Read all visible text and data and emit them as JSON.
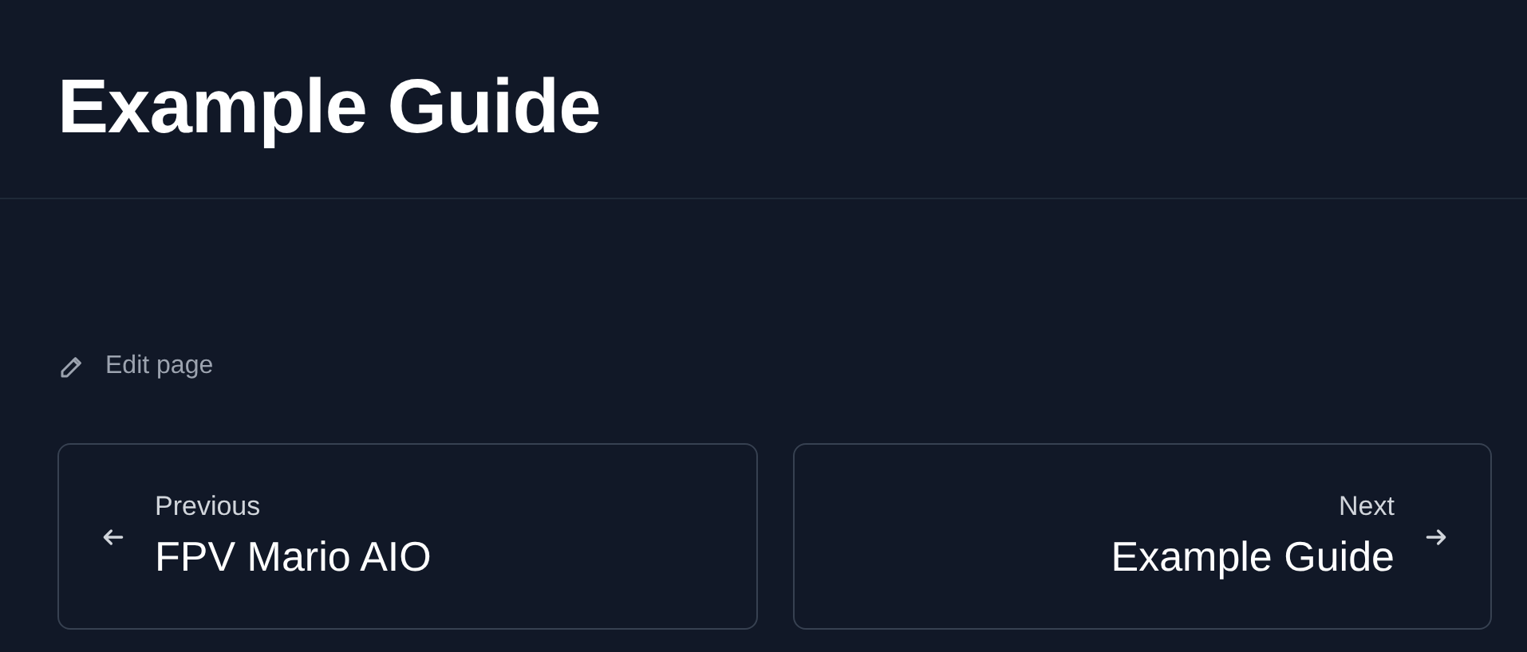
{
  "title": "Example Guide",
  "edit_link": "Edit page",
  "pagination": [
    {
      "kind": "prev",
      "label": "Previous",
      "title": "FPV Mario AIO"
    },
    {
      "kind": "next",
      "label": "Next",
      "title": "Example Guide"
    }
  ]
}
